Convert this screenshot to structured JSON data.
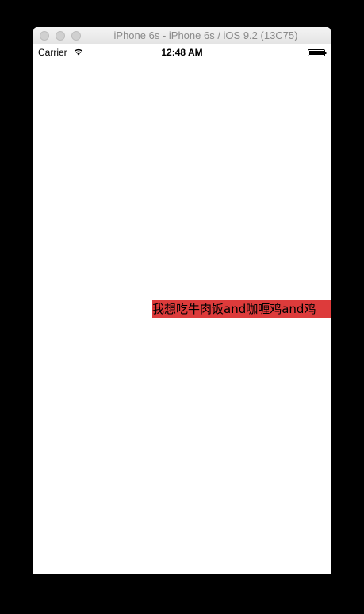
{
  "window": {
    "title": "iPhone 6s - iPhone 6s / iOS 9.2 (13C75)"
  },
  "status_bar": {
    "carrier": "Carrier",
    "time": "12:48 AM",
    "icons": [
      "wifi-icon",
      "battery-icon"
    ]
  },
  "content": {
    "label_text": "我想吃牛肉饭and咖喱鸡and鸡",
    "label_background": "#dd3b3b"
  }
}
